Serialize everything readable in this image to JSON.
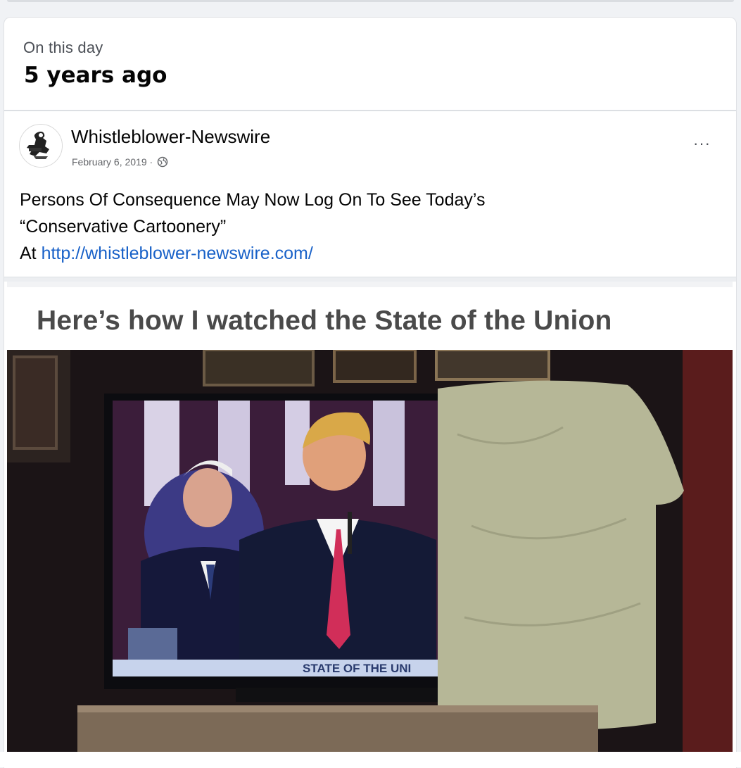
{
  "memory": {
    "heading": "On this day",
    "title": "5 years ago"
  },
  "post": {
    "author": "Whistleblower-Newswire",
    "date": "February 6, 2019",
    "date_separator": "·",
    "privacy_icon": "globe-icon",
    "more_label": "···",
    "text_line1": "Persons Of Consequence May Now Log On To See Today’s",
    "text_line2": "“Conservative Cartoonery”",
    "text_line3_prefix": "At ",
    "link": "http://whistleblower-newswire.com/"
  },
  "image": {
    "caption": "Here’s how I watched the State of the Union",
    "ticker": "STATE OF THE UNI"
  },
  "colors": {
    "link": "#1861c8",
    "page_bg": "#f0f2f5",
    "card_bg": "#ffffff"
  }
}
